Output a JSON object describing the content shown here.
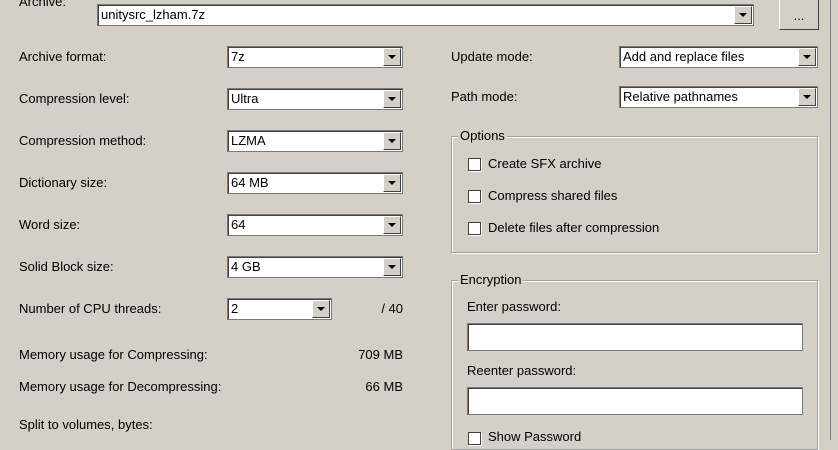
{
  "archive": {
    "label": "Archive:",
    "value": "unitysrc_lzham.7z",
    "browse_label": "..."
  },
  "left": {
    "archive_format": {
      "label": "Archive format:",
      "value": "7z"
    },
    "compression_level": {
      "label": "Compression level:",
      "value": "Ultra"
    },
    "compression_method": {
      "label": "Compression method:",
      "value": "LZMA"
    },
    "dictionary_size": {
      "label": "Dictionary size:",
      "value": "64 MB"
    },
    "word_size": {
      "label": "Word size:",
      "value": "64"
    },
    "solid_block_size": {
      "label": "Solid Block size:",
      "value": "4 GB"
    },
    "cpu_threads": {
      "label": "Number of CPU threads:",
      "value": "2",
      "max": "/ 40"
    },
    "memory_compress": {
      "label": "Memory usage for Compressing:",
      "value": "709 MB"
    },
    "memory_decompress": {
      "label": "Memory usage for Decompressing:",
      "value": "66 MB"
    },
    "split_volumes": {
      "label": "Split to volumes, bytes:"
    }
  },
  "right": {
    "update_mode": {
      "label": "Update mode:",
      "value": "Add and replace files"
    },
    "path_mode": {
      "label": "Path mode:",
      "value": "Relative pathnames"
    },
    "options": {
      "title": "Options",
      "sfx": "Create SFX archive",
      "shared": "Compress shared files",
      "delete": "Delete files after compression"
    },
    "encryption": {
      "title": "Encryption",
      "enter_password": "Enter password:",
      "reenter_password": "Reenter password:",
      "show_password": "Show Password"
    }
  }
}
